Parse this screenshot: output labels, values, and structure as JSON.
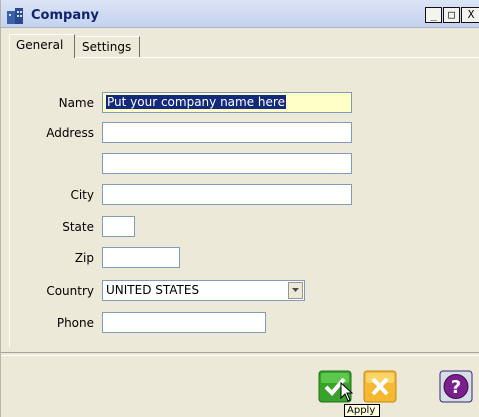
{
  "window": {
    "title": "Company",
    "controls": {
      "minimize": "_",
      "maximize": "□",
      "close": "X"
    }
  },
  "tabs": [
    {
      "label": "General",
      "active": true
    },
    {
      "label": "Settings",
      "active": false
    }
  ],
  "form": {
    "name": {
      "label": "Name",
      "value": "Put your company name here"
    },
    "address": {
      "label": "Address",
      "value1": "",
      "value2": ""
    },
    "city": {
      "label": "City",
      "value": ""
    },
    "state": {
      "label": "State",
      "value": ""
    },
    "zip": {
      "label": "Zip",
      "value": ""
    },
    "country": {
      "label": "Country",
      "value": "UNITED STATES"
    },
    "phone": {
      "label": "Phone",
      "value": ""
    }
  },
  "buttons": {
    "apply": {
      "icon": "checkmark-icon",
      "color": "#39a12c"
    },
    "cancel": {
      "icon": "x-icon",
      "color": "#f4b833"
    },
    "help": {
      "icon": "question-icon",
      "color": "#7a1f8c"
    }
  },
  "tooltip": {
    "text": "Apply"
  },
  "colors": {
    "selection": "#13297b",
    "highlight_field": "#ffffc6",
    "title_text": "#10246a"
  }
}
